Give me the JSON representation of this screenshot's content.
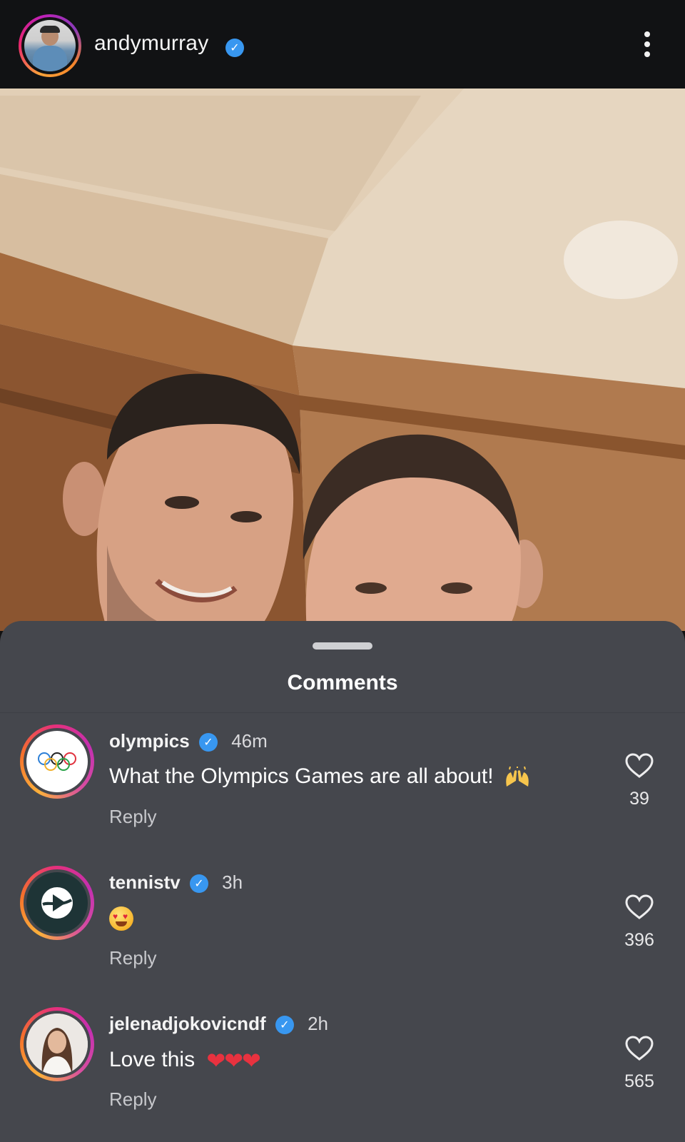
{
  "header": {
    "username": "andymurray",
    "verified": true
  },
  "sheet": {
    "title": "Comments"
  },
  "comments": [
    {
      "username": "olympics",
      "verified": true,
      "time": "46m",
      "text": "What the Olympics Games are all about!",
      "emoji": "raising-hands",
      "reply_label": "Reply",
      "likes": "39",
      "avatar": "olympic-rings-icon"
    },
    {
      "username": "tennistv",
      "verified": true,
      "time": "3h",
      "text": "",
      "emoji": "heart-eyes",
      "reply_label": "Reply",
      "likes": "396",
      "avatar": "tennistv-logo-icon"
    },
    {
      "username": "jelenadjokovicndf",
      "verified": true,
      "time": "2h",
      "text": "Love this",
      "emoji": "red-hearts",
      "reply_label": "Reply",
      "likes": "565",
      "avatar": "profile-photo"
    }
  ],
  "colors": {
    "header_bg": "#111214",
    "sheet_bg": "#45474d",
    "verified_blue": "#3897f0",
    "story_ring": "#e9266c"
  }
}
